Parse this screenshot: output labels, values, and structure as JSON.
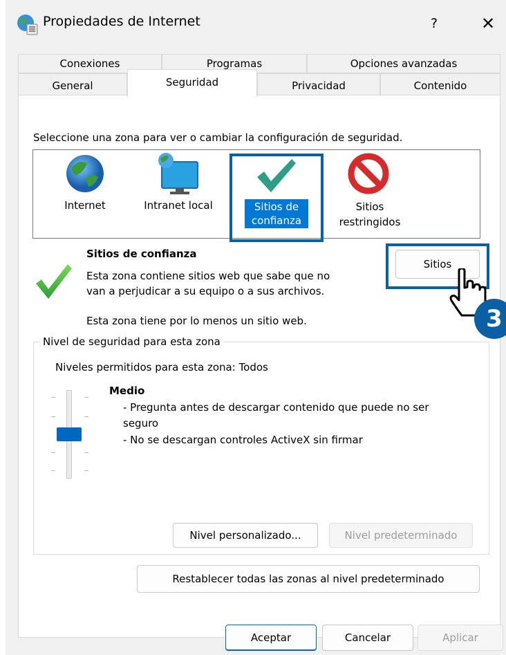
{
  "window": {
    "title": "Propiedades de Internet",
    "help_label": "?",
    "close_label": "✕"
  },
  "tabs": {
    "row1": [
      "Conexiones",
      "Programas",
      "Opciones avanzadas"
    ],
    "row2": [
      "General",
      "Seguridad",
      "Privacidad",
      "Contenido"
    ],
    "active": "Seguridad"
  },
  "security": {
    "instruction": "Seleccione una zona para ver o cambiar la configuración de seguridad.",
    "zones": [
      {
        "line1": "Internet",
        "line2": "",
        "icon": "globe-icon"
      },
      {
        "line1": "Intranet local",
        "line2": "",
        "icon": "intranet-icon"
      },
      {
        "line1": "Sitios de",
        "line2": "confianza",
        "icon": "checkmark-icon"
      },
      {
        "line1": "Sitios",
        "line2": "restringidos",
        "icon": "restricted-icon"
      }
    ],
    "selected_zone": "Sitios de confianza",
    "zone_title": "Sitios de confianza",
    "zone_desc_line1": "Esta zona contiene sitios web que sabe que no",
    "zone_desc_line2": "van a perjudicar a su equipo o a sus archivos.",
    "zone_info": "Esta zona tiene por lo menos un sitio web.",
    "sites_button": "Sitios"
  },
  "level": {
    "group_label": "Nivel de seguridad para esta zona",
    "allowed": "Niveles permitidos para esta zona: Todos",
    "level_name": "Medio",
    "bullet1_line1": "- Pregunta antes de descargar contenido que puede no ser",
    "bullet1_line2": "seguro",
    "bullet2": "- No se descargan controles ActiveX sin firmar",
    "custom_button": "Nivel personalizado...",
    "default_button": "Nivel predeterminado",
    "slider_position": "Medio"
  },
  "reset_button": "Restablecer todas las zonas al nivel predeterminado",
  "footer": {
    "ok": "Aceptar",
    "cancel": "Cancelar",
    "apply": "Aplicar"
  },
  "annotation": {
    "step_number": "3"
  },
  "colors": {
    "accent": "#0067c0",
    "selection": "#0078d4",
    "highlight_box": "#0b5fa5",
    "badge": "#0b5fa5"
  }
}
